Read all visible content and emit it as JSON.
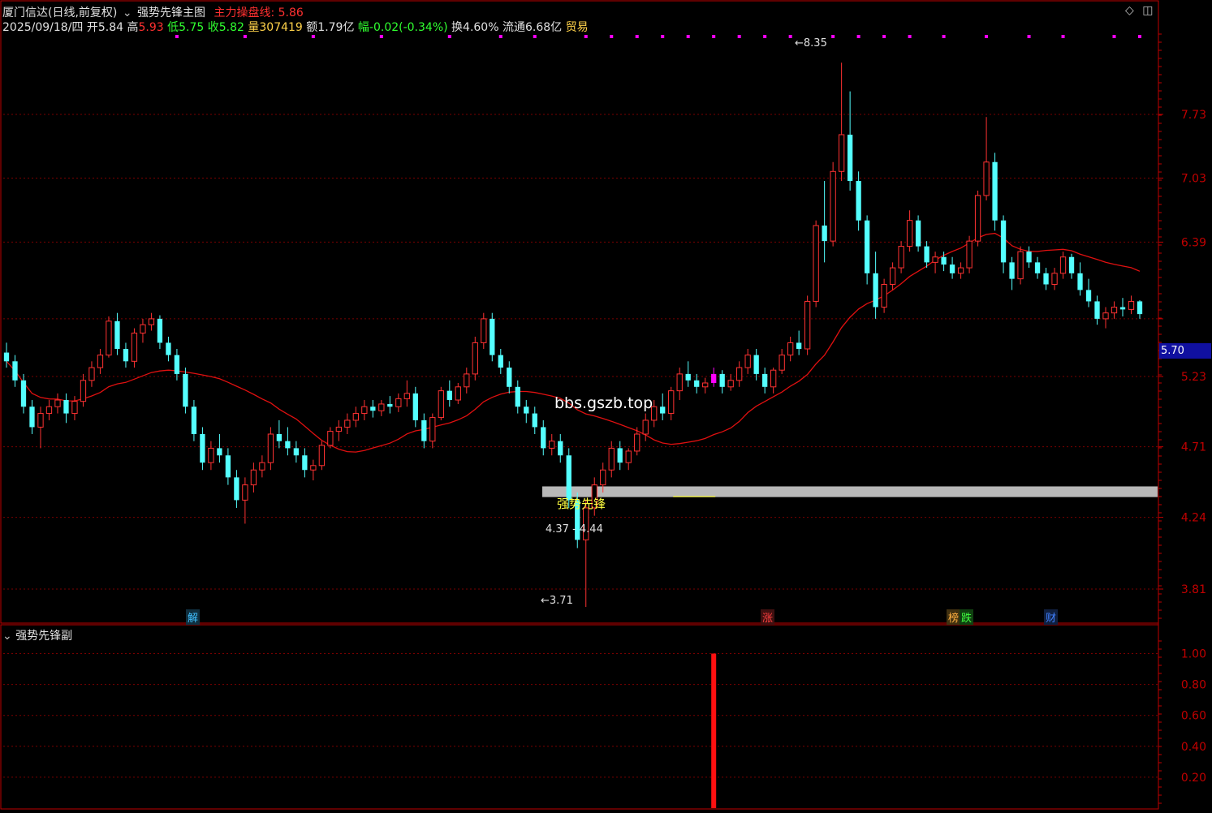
{
  "header": {
    "stock": "厦门信达(日线,前复权)",
    "formula": "强势先锋主图",
    "indicator_label": "主力操盘线:",
    "indicator_value": "5.86",
    "date": "2025/09/18/四",
    "open_label": "开",
    "open": "5.84",
    "high_label": "高",
    "high": "5.93",
    "low_label": "低",
    "low": "5.75",
    "close_label": "收",
    "close": "5.82",
    "volume_label": "量",
    "volume": "307419",
    "amount_label": "额",
    "amount": "1.79亿",
    "change_label": "幅",
    "change": "-0.02(-0.34%)",
    "turnover_label": "换",
    "turnover": "4.60%",
    "float_label": "流通",
    "float": "6.68亿",
    "industry": "贸易"
  },
  "sub_panel": {
    "title": "强势先锋副"
  },
  "annotations": {
    "high_price": "8.35",
    "low_price": "3.71",
    "signal_text": "强势先锋",
    "range_text": "4.37 - 4.44",
    "site_text": "bbs.gszb.top",
    "current_price_tag": "5.70"
  },
  "event_tags": [
    {
      "text": "解",
      "color": "#40c0ff"
    },
    {
      "text": "涨",
      "color": "#ff4040"
    },
    {
      "text": "榜",
      "color": "#ffb040"
    },
    {
      "text": "跌",
      "color": "#40ff40"
    },
    {
      "text": "财",
      "color": "#4080ff"
    }
  ],
  "colors": {
    "up": "#ff3232",
    "down": "#54ffff",
    "ma": "#e01010",
    "grid": "#7a0000",
    "axis": "#c00000",
    "signal": "#ff00ff",
    "band": "#b8b8b8"
  },
  "chart_data": [
    {
      "type": "candlestick",
      "y_ticks": [
        3.81,
        4.24,
        4.71,
        5.23,
        5.7,
        6.39,
        7.03,
        7.73
      ],
      "y_tick_labels": [
        "3.81",
        "4.24",
        "4.71",
        "5.23",
        "",
        "6.39",
        "7.03",
        "7.73"
      ],
      "ylim": [
        3.6,
        8.5
      ],
      "high": 8.35,
      "low": 3.71,
      "support_band": [
        4.37,
        4.44
      ],
      "signal_candle_index": 83,
      "series": [
        {
          "ohlc": [
            [
              5.42,
              5.5,
              5.3,
              5.35
            ],
            [
              5.35,
              5.4,
              5.15,
              5.2
            ],
            [
              5.2,
              5.25,
              4.95,
              5.0
            ],
            [
              5.0,
              5.05,
              4.8,
              4.85
            ],
            [
              4.85,
              5.0,
              4.7,
              4.95
            ],
            [
              4.95,
              5.05,
              4.9,
              5.0
            ],
            [
              5.0,
              5.1,
              4.95,
              5.05
            ],
            [
              5.05,
              5.1,
              4.88,
              4.95
            ],
            [
              4.95,
              5.08,
              4.9,
              5.04
            ],
            [
              5.04,
              5.25,
              5.0,
              5.2
            ],
            [
              5.2,
              5.35,
              5.15,
              5.3
            ],
            [
              5.3,
              5.45,
              5.25,
              5.4
            ],
            [
              5.4,
              5.72,
              5.38,
              5.68
            ],
            [
              5.68,
              5.75,
              5.4,
              5.45
            ],
            [
              5.45,
              5.5,
              5.3,
              5.35
            ],
            [
              5.35,
              5.62,
              5.3,
              5.58
            ],
            [
              5.58,
              5.7,
              5.5,
              5.65
            ],
            [
              5.65,
              5.75,
              5.6,
              5.7
            ],
            [
              5.7,
              5.73,
              5.45,
              5.5
            ],
            [
              5.5,
              5.55,
              5.35,
              5.4
            ],
            [
              5.4,
              5.45,
              5.2,
              5.25
            ],
            [
              5.25,
              5.3,
              4.95,
              5.0
            ],
            [
              5.0,
              5.05,
              4.75,
              4.8
            ],
            [
              4.8,
              4.85,
              4.55,
              4.6
            ],
            [
              4.6,
              4.75,
              4.55,
              4.7
            ],
            [
              4.7,
              4.8,
              4.6,
              4.65
            ],
            [
              4.65,
              4.7,
              4.45,
              4.5
            ],
            [
              4.5,
              4.55,
              4.3,
              4.35
            ],
            [
              4.35,
              4.5,
              4.2,
              4.45
            ],
            [
              4.45,
              4.6,
              4.4,
              4.55
            ],
            [
              4.55,
              4.65,
              4.5,
              4.6
            ],
            [
              4.6,
              4.85,
              4.55,
              4.8
            ],
            [
              4.8,
              4.9,
              4.7,
              4.75
            ],
            [
              4.75,
              4.85,
              4.65,
              4.7
            ],
            [
              4.7,
              4.75,
              4.6,
              4.65
            ],
            [
              4.65,
              4.7,
              4.5,
              4.55
            ],
            [
              4.55,
              4.62,
              4.48,
              4.58
            ],
            [
              4.58,
              4.75,
              4.55,
              4.72
            ],
            [
              4.72,
              4.85,
              4.7,
              4.82
            ],
            [
              4.82,
              4.9,
              4.75,
              4.85
            ],
            [
              4.85,
              4.95,
              4.8,
              4.9
            ],
            [
              4.9,
              5.0,
              4.85,
              4.95
            ],
            [
              4.95,
              5.05,
              4.9,
              5.0
            ],
            [
              5.0,
              5.05,
              4.92,
              4.97
            ],
            [
              4.97,
              5.05,
              4.93,
              5.02
            ],
            [
              5.02,
              5.08,
              4.95,
              5.0
            ],
            [
              5.0,
              5.1,
              4.96,
              5.06
            ],
            [
              5.06,
              5.2,
              5.0,
              5.1
            ],
            [
              5.1,
              5.15,
              4.85,
              4.9
            ],
            [
              4.9,
              4.95,
              4.7,
              4.75
            ],
            [
              4.75,
              4.95,
              4.7,
              4.92
            ],
            [
              4.92,
              5.15,
              4.9,
              5.12
            ],
            [
              5.12,
              5.2,
              5.0,
              5.05
            ],
            [
              5.05,
              5.18,
              5.02,
              5.15
            ],
            [
              5.15,
              5.3,
              5.1,
              5.25
            ],
            [
              5.25,
              5.55,
              5.2,
              5.5
            ],
            [
              5.5,
              5.75,
              5.45,
              5.7
            ],
            [
              5.7,
              5.75,
              5.35,
              5.4
            ],
            [
              5.4,
              5.45,
              5.25,
              5.3
            ],
            [
              5.3,
              5.35,
              5.1,
              5.15
            ],
            [
              5.15,
              5.2,
              4.95,
              5.0
            ],
            [
              5.0,
              5.05,
              4.88,
              4.95
            ],
            [
              4.95,
              5.0,
              4.8,
              4.85
            ],
            [
              4.85,
              4.9,
              4.65,
              4.7
            ],
            [
              4.7,
              4.8,
              4.65,
              4.75
            ],
            [
              4.75,
              4.8,
              4.6,
              4.65
            ],
            [
              4.65,
              4.7,
              4.3,
              4.35
            ],
            [
              4.35,
              4.4,
              4.05,
              4.1
            ],
            [
              4.1,
              4.35,
              3.71,
              4.3
            ],
            [
              4.3,
              4.5,
              4.25,
              4.45
            ],
            [
              4.45,
              4.6,
              4.4,
              4.55
            ],
            [
              4.55,
              4.75,
              4.5,
              4.7
            ],
            [
              4.7,
              4.75,
              4.55,
              4.6
            ],
            [
              4.6,
              4.7,
              4.55,
              4.68
            ],
            [
              4.68,
              4.85,
              4.65,
              4.8
            ],
            [
              4.8,
              4.95,
              4.75,
              4.9
            ],
            [
              4.9,
              5.05,
              4.85,
              5.0
            ],
            [
              5.0,
              5.1,
              4.9,
              4.95
            ],
            [
              4.95,
              5.15,
              4.9,
              5.12
            ],
            [
              5.12,
              5.3,
              5.05,
              5.25
            ],
            [
              5.25,
              5.35,
              5.15,
              5.2
            ],
            [
              5.2,
              5.25,
              5.1,
              5.15
            ],
            [
              5.15,
              5.22,
              5.1,
              5.18
            ],
            [
              5.18,
              5.3,
              5.15,
              5.25
            ],
            [
              5.25,
              5.28,
              5.1,
              5.15
            ],
            [
              5.15,
              5.25,
              5.12,
              5.2
            ],
            [
              5.2,
              5.35,
              5.15,
              5.3
            ],
            [
              5.3,
              5.45,
              5.25,
              5.4
            ],
            [
              5.4,
              5.45,
              5.2,
              5.25
            ],
            [
              5.25,
              5.3,
              5.1,
              5.15
            ],
            [
              5.15,
              5.3,
              5.1,
              5.28
            ],
            [
              5.28,
              5.45,
              5.25,
              5.4
            ],
            [
              5.4,
              5.55,
              5.35,
              5.5
            ],
            [
              5.5,
              5.6,
              5.4,
              5.45
            ],
            [
              5.45,
              5.9,
              5.4,
              5.85
            ],
            [
              5.85,
              6.6,
              5.8,
              6.55
            ],
            [
              6.55,
              7.0,
              6.2,
              6.4
            ],
            [
              6.4,
              7.2,
              6.35,
              7.1
            ],
            [
              7.1,
              8.35,
              7.0,
              7.5
            ],
            [
              7.5,
              8.0,
              6.9,
              7.0
            ],
            [
              7.0,
              7.1,
              6.5,
              6.6
            ],
            [
              6.6,
              6.65,
              6.0,
              6.1
            ],
            [
              6.1,
              6.3,
              5.7,
              5.8
            ],
            [
              5.8,
              6.05,
              5.75,
              6.0
            ],
            [
              6.0,
              6.2,
              5.95,
              6.15
            ],
            [
              6.15,
              6.4,
              6.1,
              6.35
            ],
            [
              6.35,
              6.7,
              6.3,
              6.6
            ],
            [
              6.6,
              6.65,
              6.3,
              6.35
            ],
            [
              6.35,
              6.4,
              6.15,
              6.2
            ],
            [
              6.2,
              6.3,
              6.1,
              6.25
            ],
            [
              6.25,
              6.3,
              6.12,
              6.18
            ],
            [
              6.18,
              6.25,
              6.05,
              6.1
            ],
            [
              6.1,
              6.2,
              6.05,
              6.15
            ],
            [
              6.15,
              6.45,
              6.1,
              6.4
            ],
            [
              6.4,
              6.9,
              6.35,
              6.85
            ],
            [
              6.85,
              7.7,
              6.8,
              7.2
            ],
            [
              7.2,
              7.3,
              6.5,
              6.6
            ],
            [
              6.6,
              6.65,
              6.1,
              6.2
            ],
            [
              6.2,
              6.25,
              5.95,
              6.05
            ],
            [
              6.05,
              6.35,
              6.0,
              6.3
            ],
            [
              6.3,
              6.35,
              6.15,
              6.2
            ],
            [
              6.2,
              6.25,
              6.05,
              6.1
            ],
            [
              6.1,
              6.15,
              5.95,
              6.0
            ],
            [
              6.0,
              6.15,
              5.95,
              6.1
            ],
            [
              6.1,
              6.3,
              6.05,
              6.25
            ],
            [
              6.25,
              6.28,
              6.05,
              6.1
            ],
            [
              6.1,
              6.2,
              5.9,
              5.95
            ],
            [
              5.95,
              6.05,
              5.8,
              5.85
            ],
            [
              5.85,
              5.9,
              5.65,
              5.7
            ],
            [
              5.7,
              5.8,
              5.62,
              5.75
            ],
            [
              5.75,
              5.85,
              5.7,
              5.8
            ],
            [
              5.8,
              5.88,
              5.72,
              5.78
            ],
            [
              5.78,
              5.9,
              5.74,
              5.85
            ],
            [
              5.85,
              5.86,
              5.7,
              5.74
            ]
          ]
        },
        {
          "name": "主力操盘线",
          "type": "line",
          "period": 20
        }
      ]
    },
    {
      "type": "bar",
      "y_ticks": [
        0.2,
        0.4,
        0.6,
        0.8,
        1.0
      ],
      "y_tick_labels": [
        "0.20",
        "0.40",
        "0.60",
        "0.80",
        "1.00"
      ],
      "ylim": [
        0,
        1.05
      ],
      "bars": [
        {
          "index": 83,
          "value": 1.0
        }
      ]
    }
  ]
}
